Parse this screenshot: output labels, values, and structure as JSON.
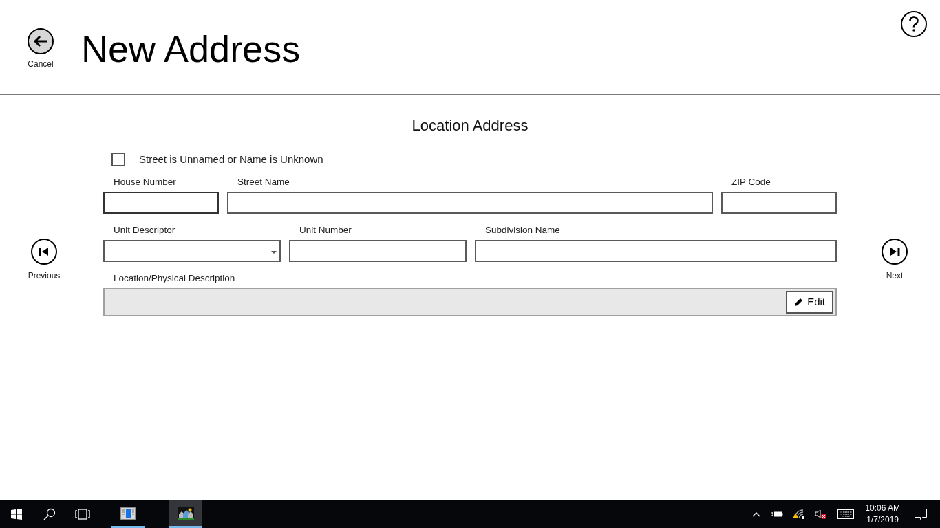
{
  "header": {
    "back_label": "Cancel",
    "title": "New Address"
  },
  "section_title": "Location Address",
  "checkbox": {
    "label": "Street is Unnamed or Name is Unknown",
    "checked": false
  },
  "field_rows": [
    [
      {
        "label": "House Number",
        "kind": "text",
        "focused": true
      },
      {
        "label": "Street Name",
        "kind": "text",
        "focused": false
      },
      {
        "label": "ZIP Code",
        "kind": "text",
        "focused": false
      }
    ],
    [
      {
        "label": "Unit Descriptor",
        "kind": "dropdown",
        "focused": false
      },
      {
        "label": "Unit Number",
        "kind": "text",
        "focused": false
      },
      {
        "label": "Subdivision Name",
        "kind": "text",
        "focused": false
      }
    ]
  ],
  "description": {
    "label": "Location/Physical Description",
    "edit_button": "Edit"
  },
  "nav": {
    "previous": "Previous",
    "next": "Next"
  },
  "taskbar": {
    "apps": [
      {
        "selected": false
      },
      {
        "selected": true
      }
    ],
    "time": "10:06 AM",
    "date": "1/7/2019"
  }
}
